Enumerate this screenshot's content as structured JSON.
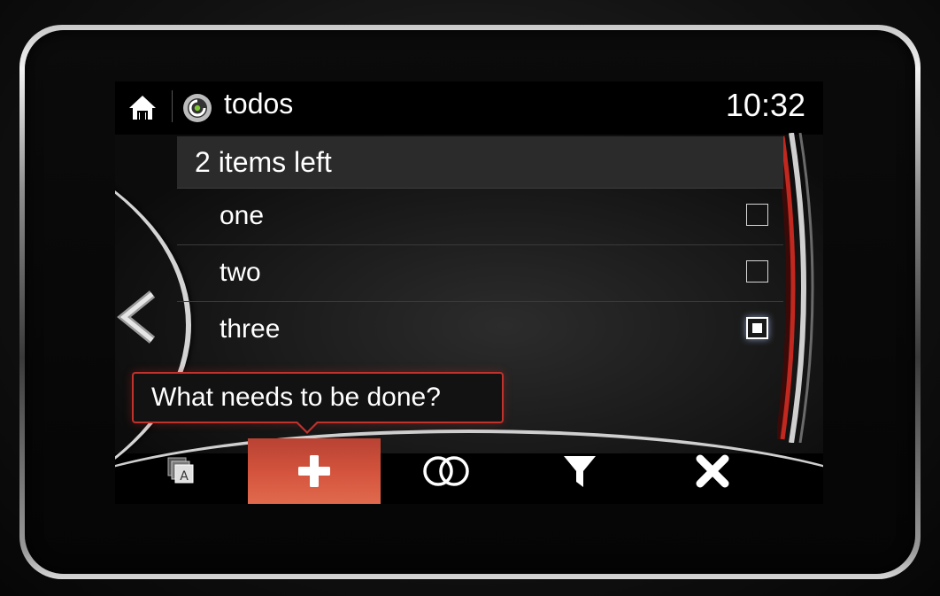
{
  "header": {
    "home_icon": "home-icon",
    "app_icon": "app-logo-icon",
    "title": "todos",
    "clock": "10:32"
  },
  "list": {
    "header": "2 items left",
    "items": [
      {
        "label": "one",
        "checked": false
      },
      {
        "label": "two",
        "checked": false
      },
      {
        "label": "three",
        "checked": true
      }
    ]
  },
  "input": {
    "placeholder": "What needs to be done?"
  },
  "toolbar": {
    "items": [
      {
        "icon": "text-size-icon",
        "active": false
      },
      {
        "icon": "plus-icon",
        "active": true
      },
      {
        "icon": "toggle-all-icon",
        "active": false
      },
      {
        "icon": "filter-icon",
        "active": false
      },
      {
        "icon": "close-icon",
        "active": false
      }
    ]
  },
  "colors": {
    "accent": "#d5553e",
    "scroll_red": "#c1281f",
    "background": "#000000"
  }
}
